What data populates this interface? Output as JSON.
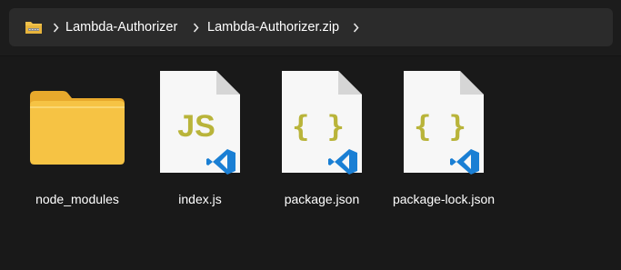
{
  "address_bar": {
    "breadcrumbs": [
      "Lambda-Authorizer",
      "Lambda-Authorizer.zip"
    ]
  },
  "files": [
    {
      "name": "node_modules",
      "icon": "folder-icon"
    },
    {
      "name": "index.js",
      "icon": "js-file-icon",
      "glyph": "JS"
    },
    {
      "name": "package.json",
      "icon": "json-file-icon",
      "glyph": "{ }"
    },
    {
      "name": "package-lock.json",
      "icon": "json-file-icon",
      "glyph": "{ }"
    }
  ],
  "colors": {
    "background": "#191919",
    "folder": "#f6c344",
    "file_glyph": "#b9b43a",
    "vscode_badge": "#1a7fd4"
  }
}
